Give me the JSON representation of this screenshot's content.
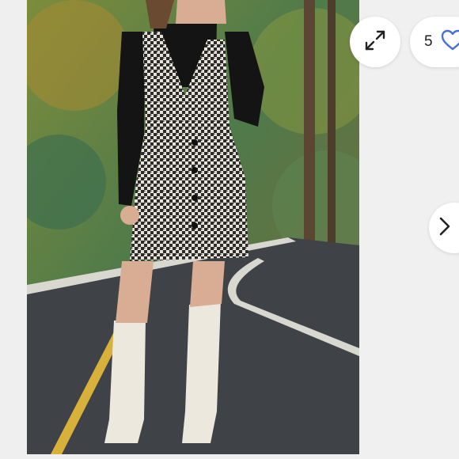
{
  "viewer": {
    "like_count": "5",
    "colors": {
      "accent": "#4a6fd6",
      "icon": "#222222",
      "button_bg": "#ffffff"
    },
    "icons": {
      "expand": "expand-arrows-icon",
      "like": "heart-outline-icon",
      "next": "chevron-right-icon"
    }
  }
}
